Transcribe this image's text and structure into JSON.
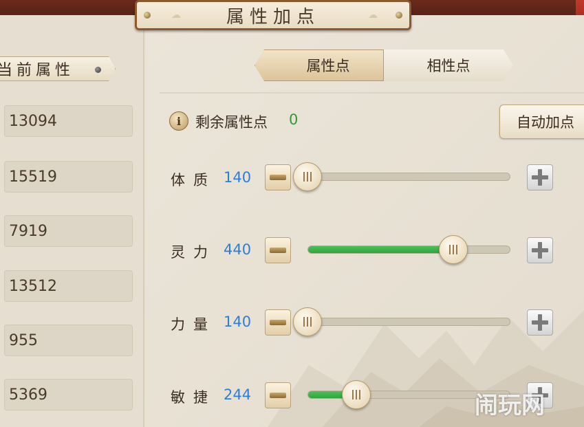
{
  "title": "属性加点",
  "current_attr_header": "当前属性",
  "current_values": [
    "13094",
    "15519",
    "7919",
    "13512",
    "955",
    "5369"
  ],
  "tabs": [
    {
      "label": "属性点",
      "active": true
    },
    {
      "label": "相性点",
      "active": false
    }
  ],
  "remaining": {
    "label": "剩余属性点",
    "value": "0"
  },
  "auto_button_label": "自动加点",
  "attributes": [
    {
      "label": "体质",
      "value": "140",
      "level": 0.0
    },
    {
      "label": "灵力",
      "value": "440",
      "level": 0.72
    },
    {
      "label": "力量",
      "value": "140",
      "level": 0.0
    },
    {
      "label": "敏捷",
      "value": "244",
      "level": 0.24
    }
  ],
  "watermark": "闹玩网",
  "colors": {
    "value_blue": "#2c7fd8",
    "remaining_green": "#2f9a2f",
    "slider_fill": "#2ea63c"
  },
  "icons": {
    "info": "info-icon",
    "minus": "minus-icon",
    "plus": "plus-icon"
  }
}
